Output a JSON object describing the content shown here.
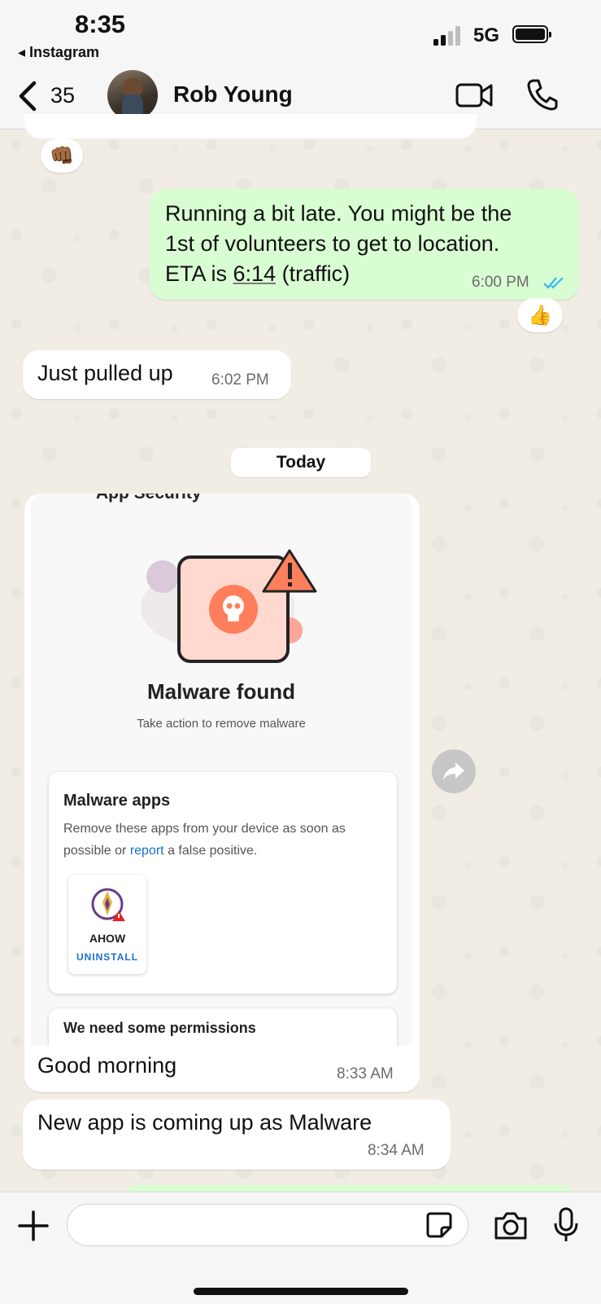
{
  "status_bar": {
    "time": "8:35",
    "back_app": "◂ Instagram",
    "network": "5G"
  },
  "header": {
    "back_count": "35",
    "contact_name": "Rob Young"
  },
  "messages": {
    "m1": {
      "text_lines": [
        "Running a bit late. You might be the",
        "1st of volunteers to get to location.",
        "ETA is "
      ],
      "eta_time": "6:14",
      "eta_suffix": " (traffic)",
      "time": "6:00 PM",
      "reaction": "👍"
    },
    "m0_reaction": "👊🏾",
    "m2": {
      "text": "Just pulled up",
      "time": "6:02 PM"
    },
    "date_chip": "Today",
    "m3": {
      "text": "Good morning",
      "time": "8:33 AM"
    },
    "m4": {
      "text": "New app is coming up as Malware",
      "time": "8:34 AM"
    }
  },
  "attachment": {
    "header": "App Security",
    "title": "Malware found",
    "subtitle": "Take action to remove malware",
    "card_title": "Malware apps",
    "card_desc_1": "Remove these apps from your device as soon as possible or ",
    "card_link": "report",
    "card_desc_2": " a false positive.",
    "app_name": "AHOW",
    "app_action": "UNINSTALL",
    "card2_title": "We need some permissions"
  },
  "colors": {
    "outgoing_bubble": "#d9fdd3",
    "incoming_bubble": "#ffffff",
    "link_blue": "#1a6fd1",
    "read_ticks": "#34b7f1",
    "malware_salmon": "#ff7f5c"
  }
}
